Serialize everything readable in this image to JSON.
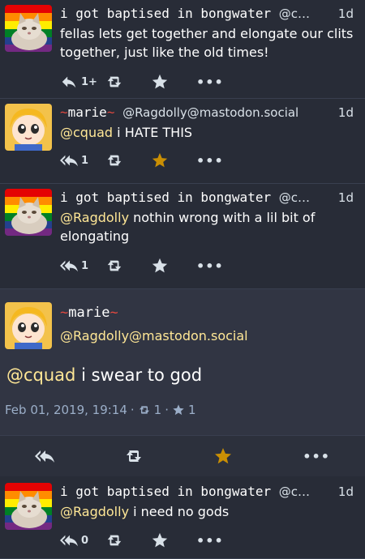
{
  "statuses": [
    {
      "display_name": "i got baptised in bongwater",
      "acct": "@c…",
      "time": "1d",
      "content": "fellas lets get together and elongate our clits together, just like the old times!",
      "reply_count": "1+",
      "favourited": false
    },
    {
      "display_name": "marie",
      "acct": "@Ragdolly@mastodon.social",
      "time": "1d",
      "mention": "@cquad",
      "content": "i HATE THIS",
      "reply_count": "1",
      "favourited": true
    },
    {
      "display_name": "i got baptised in bongwater",
      "acct": "@c…",
      "time": "1d",
      "mention": "@Ragdolly",
      "content": "nothin wrong with a lil bit of elongating",
      "reply_count": "1",
      "favourited": false
    }
  ],
  "detail": {
    "display_name": "marie",
    "acct": "@Ragdolly@mastodon.social",
    "mention": "@cquad",
    "content": "i swear to god",
    "date": "Feb 01, 2019, 19:14",
    "sep": "·",
    "boosts": "1",
    "favourites": "1"
  },
  "reply": {
    "display_name": "i got baptised in bongwater",
    "acct": "@c…",
    "time": "1d",
    "mention": "@Ragdolly",
    "content": "i need no gods",
    "reply_count": "0"
  },
  "icons": {
    "reply": "reply-icon",
    "reply_all": "reply-all-icon",
    "boost": "retweet-icon",
    "favourite": "star-icon",
    "more": "ellipsis-icon"
  },
  "more_label": "•••",
  "colors": {
    "background": "#282c37",
    "mention": "#ffe796",
    "star": "#ca8f04"
  }
}
